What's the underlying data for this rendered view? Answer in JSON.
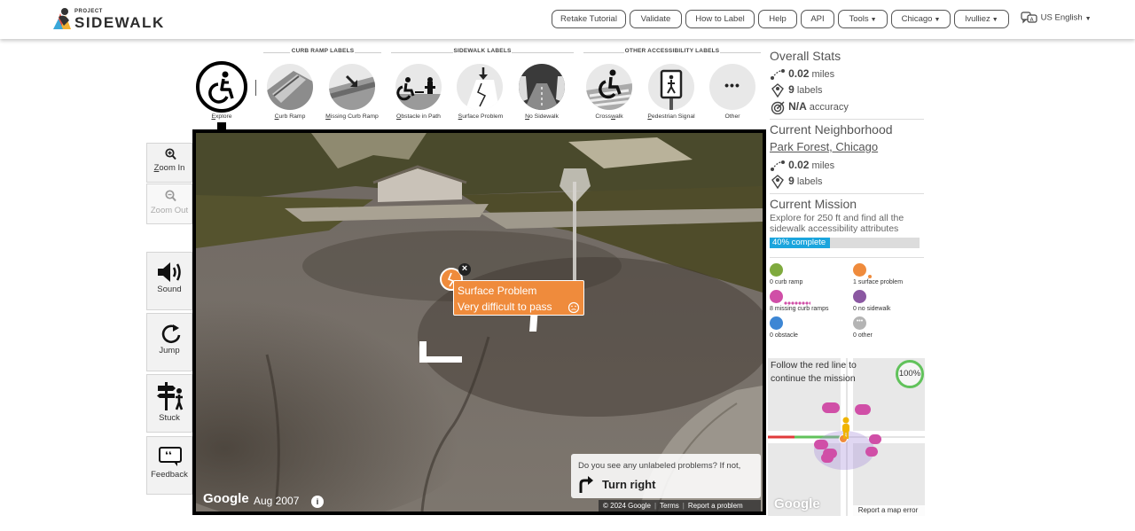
{
  "header": {
    "logo_small": "PROJECT",
    "logo_big": "SIDEWALK",
    "nav": {
      "retake_tutorial": "Retake Tutorial",
      "validate": "Validate",
      "how_to_label": "How to Label",
      "help": "Help",
      "api": "API",
      "tools": "Tools",
      "city": "Chicago",
      "user": "lvulliez"
    },
    "language": "US English"
  },
  "toolbar": {
    "groups": {
      "curb_ramp": "CURB RAMP LABELS",
      "sidewalk": "SIDEWALK LABELS",
      "other": "OTHER ACCESSIBILITY LABELS"
    },
    "tools": [
      {
        "key": "E",
        "rest": "xplore"
      },
      {
        "key": "C",
        "rest": "urb Ramp"
      },
      {
        "key": "M",
        "rest": "issing Curb Ramp"
      },
      {
        "key": "O",
        "rest": "bstacle in Path"
      },
      {
        "key": "S",
        "rest": "urface Problem"
      },
      {
        "key": "N",
        "rest": "o Sidewalk"
      },
      {
        "pre": "Cross",
        "key": "w",
        "rest": "alk"
      },
      {
        "key": "P",
        "rest": "edestrian Signal"
      },
      {
        "pre": "",
        "key": "",
        "rest": "Other"
      }
    ],
    "more_glyph": "•••"
  },
  "controls": {
    "zoom_in": {
      "key": "Z",
      "rest": "oom In"
    },
    "zoom_out": "Zoom Out",
    "sound": "Sound",
    "jump": "Jump",
    "stuck": "Stuck",
    "feedback": "Feedback"
  },
  "pano": {
    "label_title": "Surface Problem",
    "label_severity": "Very difficult to pass",
    "close_glyph": "×",
    "prompt": "Do you see any unlabeled problems? If not,",
    "action": "Turn right",
    "google": "Google",
    "date": "Aug 2007",
    "info_glyph": "i",
    "copyright": "© 2024 Google",
    "terms": "Terms",
    "report": "Report a problem"
  },
  "sidebar": {
    "overall": {
      "title": "Overall Stats",
      "miles": "0.02",
      "miles_unit": "miles",
      "labels": "9",
      "labels_unit": "labels",
      "accuracy": "N/A",
      "accuracy_unit": "accuracy"
    },
    "neighborhood": {
      "title": "Current Neighborhood",
      "name": "Park Forest, Chicago",
      "miles": "0.02",
      "miles_unit": "miles",
      "labels": "9",
      "labels_unit": "labels"
    },
    "mission": {
      "title": "Current Mission",
      "description": "Explore for 250 ft and find all the sidewalk accessibility attributes",
      "progress_text": "40% complete",
      "progress": 0.4,
      "progress_color": "#1ba5dd"
    },
    "legend": {
      "curb_ramp": "0 curb ramp",
      "surface_problem": "1 surface problem",
      "missing_curb_ramps": "8 missing curb ramps",
      "no_sidewalk": "0 no sidewalk",
      "obstacle": "0 obstacle",
      "other": "0 other"
    },
    "minimap": {
      "instruction": "Follow the red line to continue the mission",
      "percent": "100%",
      "google": "Google",
      "report": "Report a map error"
    }
  },
  "colors": {
    "surface_orange": "#ef8b3c",
    "curb_green": "#7faa3e",
    "missing_pink": "#d04fa7",
    "no_sidewalk_purple": "#8b58a2",
    "obstacle_blue": "#3d86d4",
    "other_gray": "#b4b4b4"
  }
}
